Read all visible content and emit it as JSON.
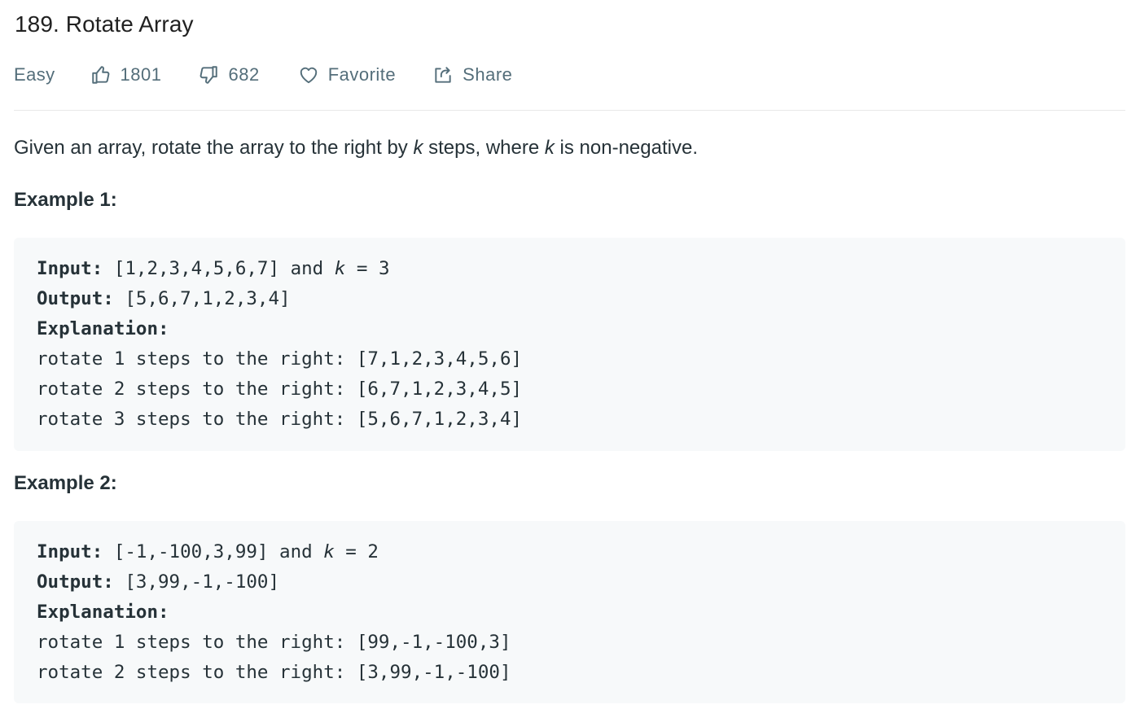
{
  "problem": {
    "title": "189. Rotate Array",
    "difficulty": "Easy",
    "likes": "1801",
    "dislikes": "682",
    "favorite_label": "Favorite",
    "share_label": "Share"
  },
  "description": {
    "part1": "Given an array, rotate the array to the right by ",
    "var1": "k",
    "part2": " steps, where ",
    "var2": "k",
    "part3": " is non-negative."
  },
  "examples": [
    {
      "heading": "Example 1:",
      "input_label": "Input:",
      "input_value": " [1,2,3,4,5,6,7] and ",
      "input_var": "k",
      "input_tail": " = 3",
      "output_label": "Output:",
      "output_value": " [5,6,7,1,2,3,4]",
      "explanation_label": "Explanation:",
      "steps": [
        "rotate 1 steps to the right: [7,1,2,3,4,5,6]",
        "rotate 2 steps to the right: [6,7,1,2,3,4,5]",
        "rotate 3 steps to the right: [5,6,7,1,2,3,4]"
      ]
    },
    {
      "heading": "Example 2:",
      "input_label": "Input:",
      "input_value": " [-1,-100,3,99] and ",
      "input_var": "k",
      "input_tail": " = 2",
      "output_label": "Output:",
      "output_value": " [3,99,-1,-100]",
      "explanation_label": "Explanation:",
      "steps": [
        "rotate 1 steps to the right: [99,-1,-100,3]",
        "rotate 2 steps to the right: [3,99,-1,-100]"
      ]
    }
  ],
  "icons": {
    "like": "thumbs-up-icon",
    "dislike": "thumbs-down-icon",
    "favorite": "heart-icon",
    "share": "share-icon"
  },
  "colors": {
    "text": "#212121",
    "meta": "#546e7a",
    "code_background": "#f7f9fa",
    "divider": "#e8e8e8"
  }
}
